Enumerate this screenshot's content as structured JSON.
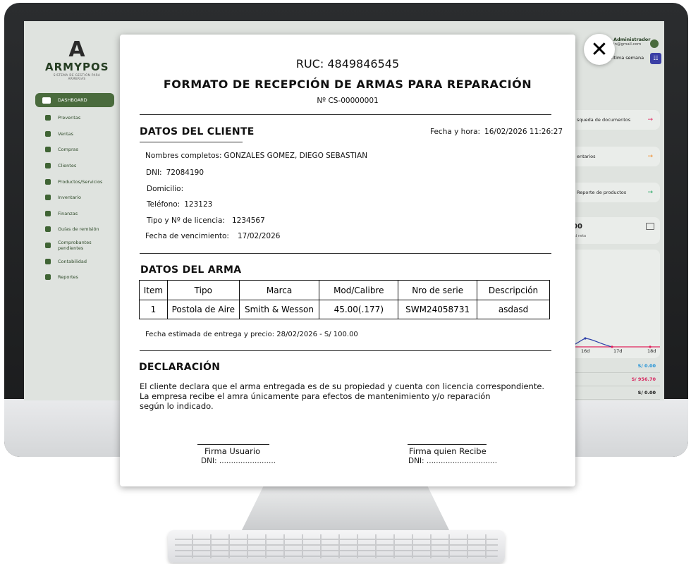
{
  "app": {
    "logo": {
      "mark": "A",
      "name": "ARMYPOS",
      "tagline": "SISTEMA DE GESTIÓN PARA ARMERIAS"
    },
    "nav": [
      {
        "label": "DASHBOARD",
        "active": true
      },
      {
        "label": "Preventas"
      },
      {
        "label": "Ventas"
      },
      {
        "label": "Compras"
      },
      {
        "label": "Clientes"
      },
      {
        "label": "Productos/Servicios"
      },
      {
        "label": "Inventario"
      },
      {
        "label": "Finanzas"
      },
      {
        "label": "Guías de remisión"
      },
      {
        "label": "Comprobantes pendientes"
      },
      {
        "label": "Contabilidad"
      },
      {
        "label": "Reportes"
      }
    ],
    "user": {
      "name": "Administrador",
      "email": "in@gmail.com"
    },
    "period_label": "Última semana",
    "quick_actions": [
      {
        "label": "squeda de documentos",
        "arrow_color": "#e0245e"
      },
      {
        "label": "entarios",
        "arrow_color": "#f08a24"
      },
      {
        "label": "Reporte de productos",
        "arrow_color": "#1aa35a"
      }
    ],
    "money_card": {
      "value": "00",
      "label": "ad neta"
    },
    "chart_ticks": [
      "16d",
      "17d",
      "18d"
    ],
    "totals": [
      {
        "value": "S/ 0.00",
        "color": "#1a8fd6"
      },
      {
        "value": "S/ 956.70",
        "color": "#d6265e"
      },
      {
        "value": "S/ 0.00",
        "color": "#111111"
      }
    ]
  },
  "document": {
    "ruc": "RUC: 4849846545",
    "title": "FORMATO DE RECEPCIÓN DE ARMAS PARA REPARACIÓN",
    "number": "Nº CS-00000001",
    "client_section": {
      "title": "DATOS DEL CLIENTE",
      "datetime_label": "Fecha y hora:",
      "datetime_value": "16/02/2026 11:26:27",
      "fields": {
        "name_label": "Nombres completos:",
        "name_value": "GONZALES GOMEZ, DIEGO SEBASTIAN",
        "dni_label": "DNI:",
        "dni_value": "72084190",
        "address_label": "Domicilio:",
        "address_value": "",
        "phone_label": "Teléfono:",
        "phone_value": "123123",
        "license_label": "Tipo y Nº de licencia:",
        "license_value": "1234567",
        "expiry_label": "Fecha de vencimiento:",
        "expiry_value": "17/02/2026"
      }
    },
    "weapon_section": {
      "title": "DATOS DEL ARMA",
      "columns": [
        "Item",
        "Tipo",
        "Marca",
        "Mod/Calibre",
        "Nro de serie",
        "Descripción"
      ],
      "rows": [
        [
          "1",
          "Postola de Aire",
          "Smith & Wesson",
          "45.00(.177)",
          "SWM24058731",
          "asdasd"
        ]
      ],
      "estimate": "Fecha estimada de entrega y precio: 28/02/2026 - S/ 100.00"
    },
    "declaration": {
      "title": "DECLARACIÓN",
      "line1": "El cliente declara que el arma entregada es de su propiedad y cuenta con licencia correspondiente.",
      "line2": "La empresa recibe el amra únicamente para efectos de mantenimiento y/o reparación",
      "line3": "según lo indicado."
    },
    "signatures": {
      "user_label": "Firma Usuario",
      "user_dni": "DNI: ........................",
      "receiver_label": "Firma quien Recibe",
      "receiver_dni": "DNI: .............................."
    }
  },
  "close_icon": "close-icon"
}
